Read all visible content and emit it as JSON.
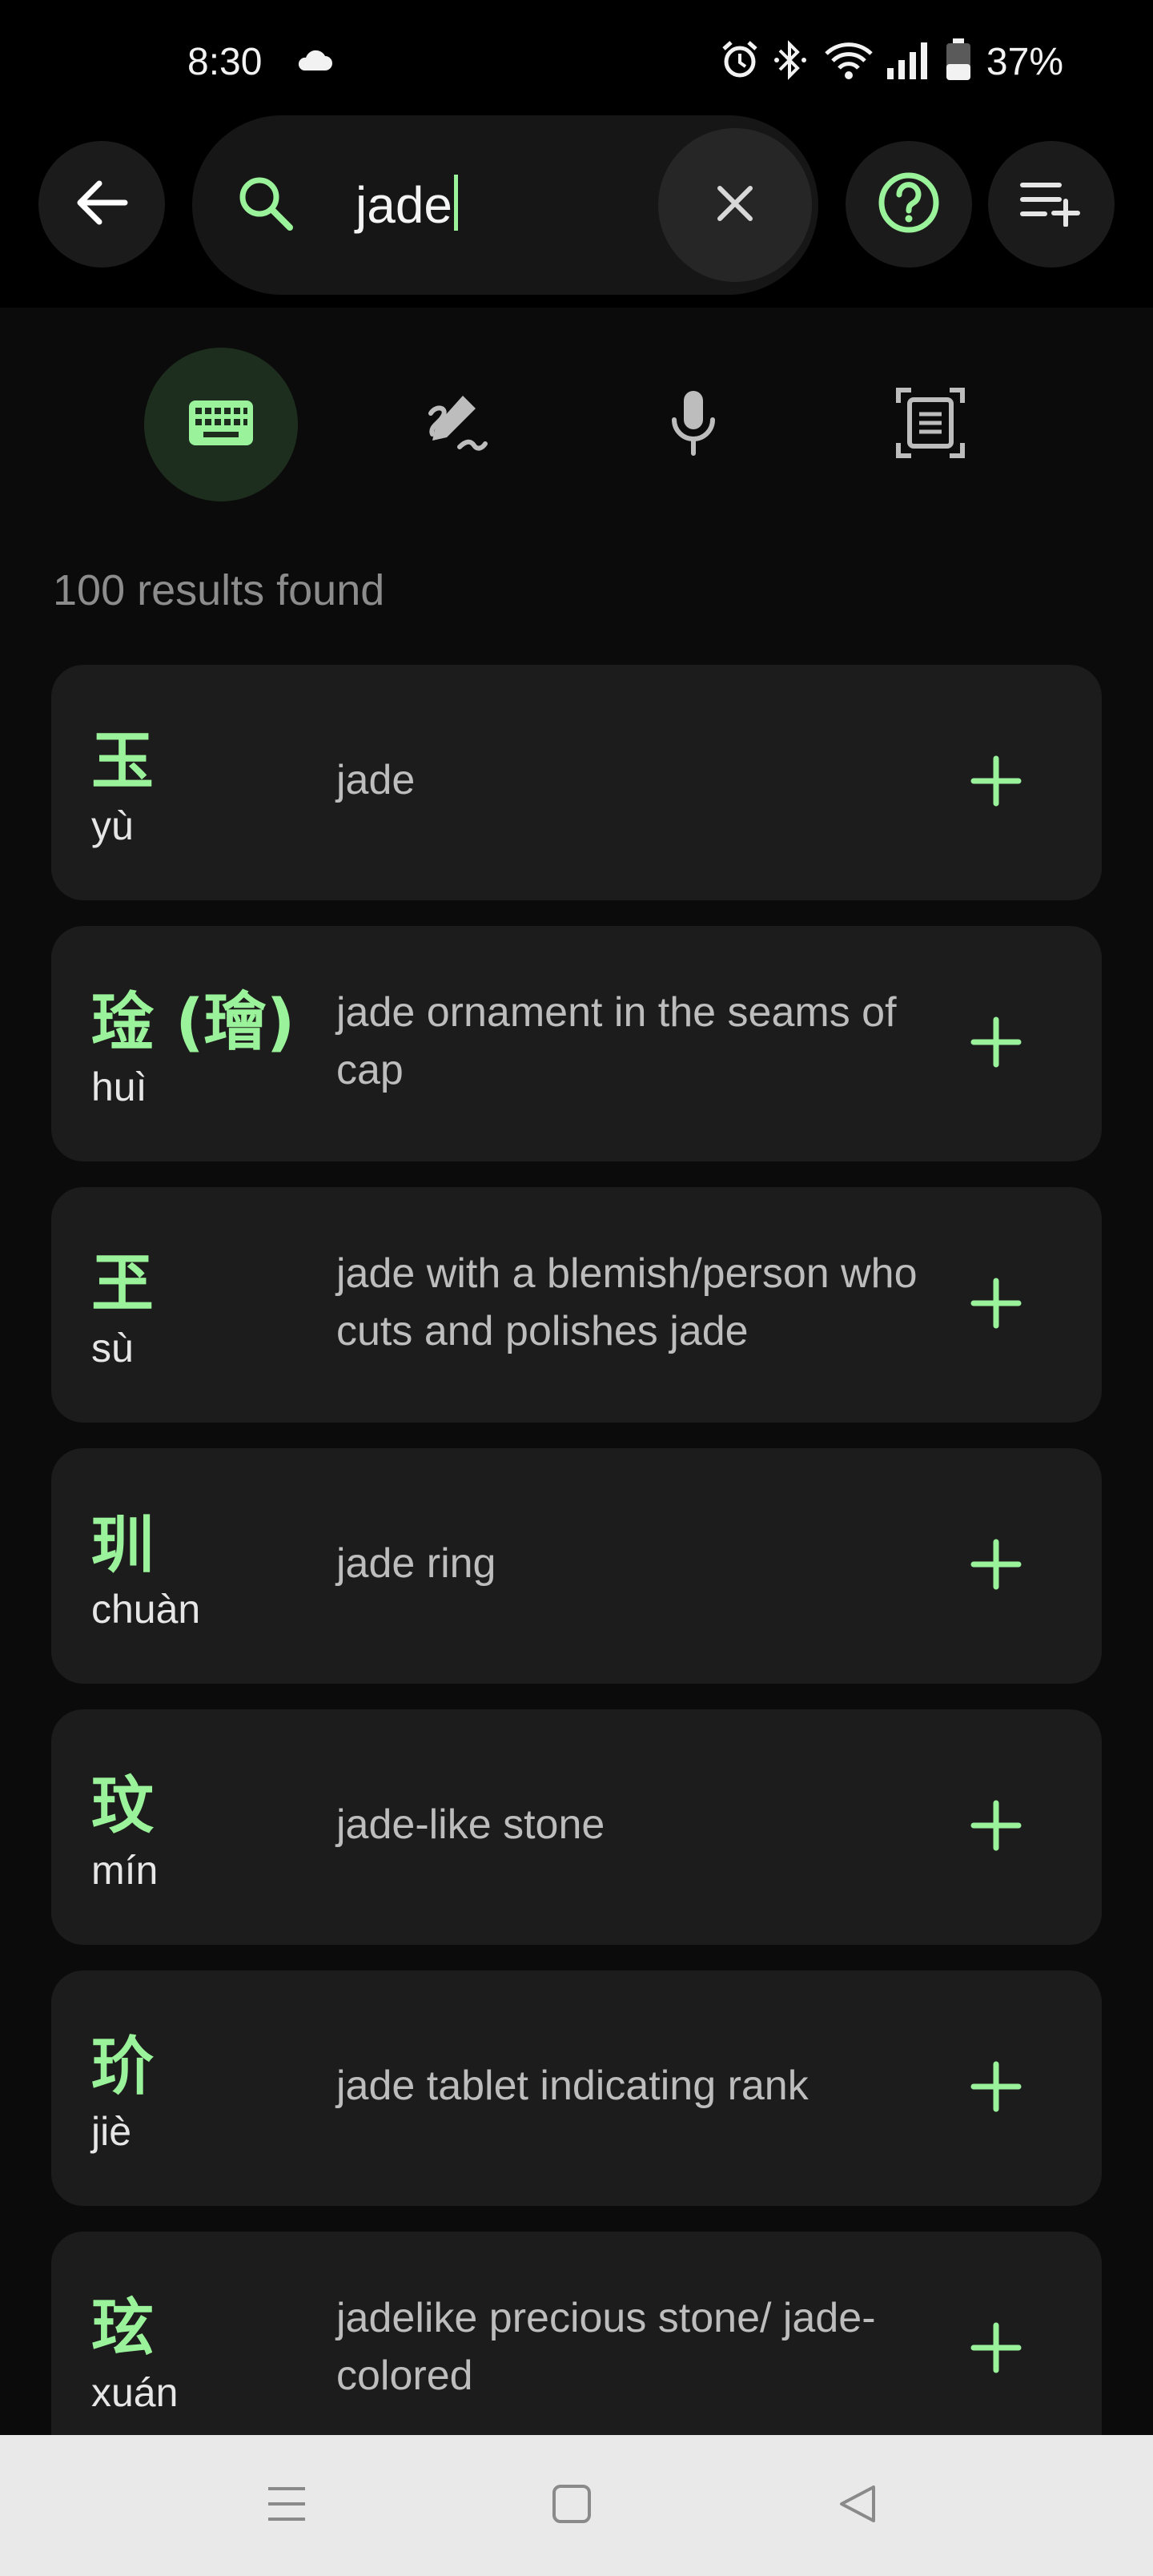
{
  "status_bar": {
    "time": "8:30",
    "battery": "37%",
    "icons": [
      "cloud-icon",
      "alarm-icon",
      "bluetooth-icon",
      "wifi-icon",
      "signal-icon",
      "battery-icon"
    ]
  },
  "search": {
    "value": "jade",
    "icons": [
      "back-arrow-icon",
      "search-icon",
      "clear-icon",
      "help-icon",
      "add-list-icon"
    ]
  },
  "input_modes": [
    "keyboard-icon",
    "handwriting-icon",
    "microphone-icon",
    "scan-icon"
  ],
  "results_count": "100 results found",
  "results": [
    {
      "hanzi": "玉",
      "pinyin": "yù",
      "meaning": "jade"
    },
    {
      "hanzi": "琻 (璯)",
      "pinyin": "huì",
      "meaning": "jade ornament in the seams of cap"
    },
    {
      "hanzi": "玊",
      "pinyin": "sù",
      "meaning": "jade with a blemish/person who cuts and polishes jade"
    },
    {
      "hanzi": "玔",
      "pinyin": "chuàn",
      "meaning": "jade ring"
    },
    {
      "hanzi": "玟",
      "pinyin": "mín",
      "meaning": "jade-like stone"
    },
    {
      "hanzi": "玠",
      "pinyin": "jiè",
      "meaning": "jade tablet indicating rank"
    },
    {
      "hanzi": "玹",
      "pinyin": "xuán",
      "meaning": "jadelike precious stone/ jade-colored"
    }
  ],
  "colors": {
    "accent": "#9af29a",
    "background": "#0b0b0b",
    "card": "#1c1c1c",
    "navbar": "#e9e9e9"
  }
}
